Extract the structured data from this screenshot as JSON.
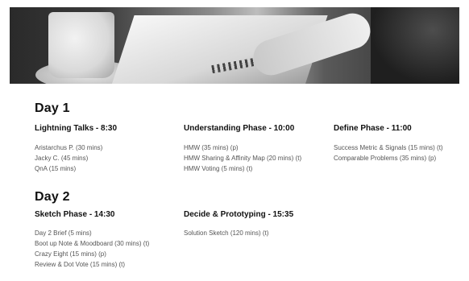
{
  "days": [
    {
      "title": "Day 1",
      "phases": [
        {
          "title": "Lightning Talks - 8:30",
          "items": [
            "Aristarchus P. (30 mins)",
            "Jacky C. (45 mins)",
            "QnA (15 mins)"
          ]
        },
        {
          "title": "Understanding Phase - 10:00",
          "items": [
            "HMW (35 mins) (p)",
            "HMW Sharing & Affinity Map (20 mins) (t)",
            "HMW Voting (5 mins) (t)"
          ]
        },
        {
          "title": "Define Phase - 11:00",
          "items": [
            "Success Metric & Signals (15 mins) (t)",
            "Comparable Problems (35 mins) (p)"
          ]
        }
      ]
    },
    {
      "title": "Day 2",
      "phases": [
        {
          "title": "Sketch Phase - 14:30",
          "items": [
            "Day 2 Brief (5 mins)",
            "Boot up Note & Moodboard (30 mins) (t)",
            "Crazy Eight (15 mins) (p)",
            "Review & Dot Vote (15 mins) (t)"
          ]
        },
        {
          "title": "Decide & Prototyping - 15:35",
          "items": [
            "Solution Sketch (120 mins) (t)"
          ]
        }
      ]
    }
  ]
}
